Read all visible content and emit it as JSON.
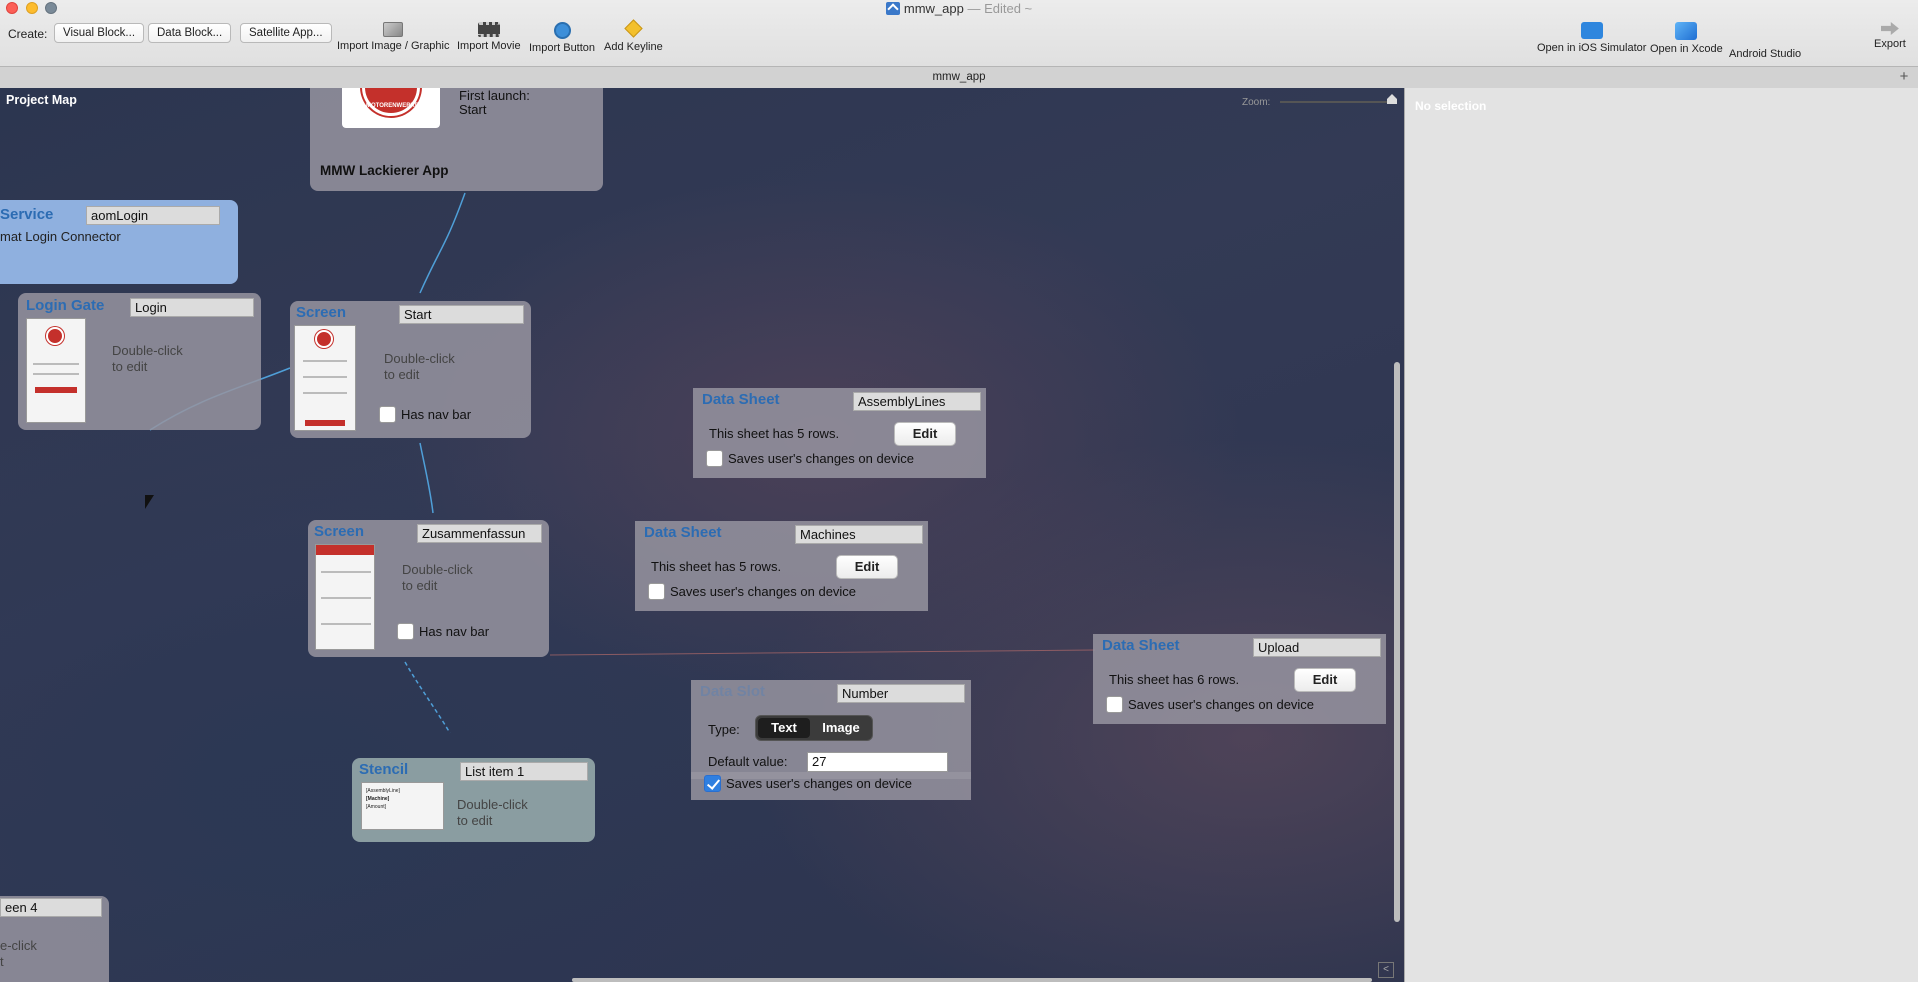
{
  "window": {
    "title": "mmw_app",
    "edited": "— Edited ~"
  },
  "toolbar": {
    "create_label": "Create:",
    "create_buttons": [
      "Visual Block...",
      "Data Block...",
      "Satellite App..."
    ],
    "tools": [
      {
        "label": "Import Image / Graphic",
        "icon": "image-graphic-icon"
      },
      {
        "label": "Import Movie",
        "icon": "movie-icon"
      },
      {
        "label": "Import Button",
        "icon": "button-icon"
      },
      {
        "label": "Add Keyline",
        "icon": "keyline-icon"
      }
    ],
    "right_tools": [
      {
        "label": "Open in iOS Simulator",
        "icon": "ios-simulator-icon"
      },
      {
        "label": "Open in Xcode",
        "icon": "xcode-icon"
      },
      {
        "label": "Android Studio",
        "icon": "android-studio-icon"
      },
      {
        "label": "Export",
        "icon": "export-icon"
      }
    ]
  },
  "tab": {
    "label": "mmw_app",
    "add": "+"
  },
  "canvas": {
    "title": "Project Map",
    "zoom_label": "Zoom:",
    "corner_icon": "<"
  },
  "blocks": {
    "app": {
      "name": "MMW Lackierer App",
      "logo_text": "MOTORENWERKE",
      "first_launch_label": "First launch:",
      "first_launch_value": "Start"
    },
    "service": {
      "type": "Service",
      "name": "aomLogin",
      "description": "mat Login Connector"
    },
    "login_gate": {
      "type": "Login Gate",
      "name": "Login",
      "hint_line1": "Double-click",
      "hint_line2": "to edit"
    },
    "screen_start": {
      "type": "Screen",
      "name": "Start",
      "hint_line1": "Double-click",
      "hint_line2": "to edit",
      "nav_label": "Has nav bar",
      "nav_checked": false
    },
    "screen_summary": {
      "type": "Screen",
      "name": "Zusammenfassun",
      "hint_line1": "Double-click",
      "hint_line2": "to edit",
      "nav_label": "Has nav bar",
      "nav_checked": false
    },
    "stencil": {
      "type": "Stencil",
      "name": "List item 1",
      "hint_line1": "Double-click",
      "hint_line2": "to edit",
      "thumb_lines": [
        "[AssemblyLine]",
        "[Machine]",
        "[Amount]"
      ]
    },
    "screen4": {
      "name": "een 4",
      "hint_line1": "e-click",
      "hint_line2": "t"
    },
    "sheet_assembly": {
      "type": "Data Sheet",
      "name": "AssemblyLines",
      "rows_text": "This sheet has 5 rows.",
      "edit": "Edit",
      "save_label": "Saves user's changes on device",
      "save_checked": false
    },
    "sheet_machines": {
      "type": "Data Sheet",
      "name": "Machines",
      "rows_text": "This sheet has 5 rows.",
      "edit": "Edit",
      "save_label": "Saves user's changes on device",
      "save_checked": false
    },
    "sheet_upload": {
      "type": "Data Sheet",
      "name": "Upload",
      "rows_text": "This sheet has 6 rows.",
      "edit": "Edit",
      "save_label": "Saves user's changes on device",
      "save_checked": false
    },
    "slot_number": {
      "type": "Data Slot",
      "name": "Number",
      "type_label": "Type:",
      "type_options": [
        "Text",
        "Image"
      ],
      "type_selected": "Text",
      "default_label": "Default value:",
      "default_value": "27",
      "save_label": "Saves user's changes on device",
      "save_checked": true
    }
  },
  "inspector": {
    "empty_text": "No selection"
  },
  "colors": {
    "accent": "#2c6cb3",
    "canvas": "#2c3650",
    "check": "#2f7fe0",
    "brand_red": "#c4302b"
  }
}
